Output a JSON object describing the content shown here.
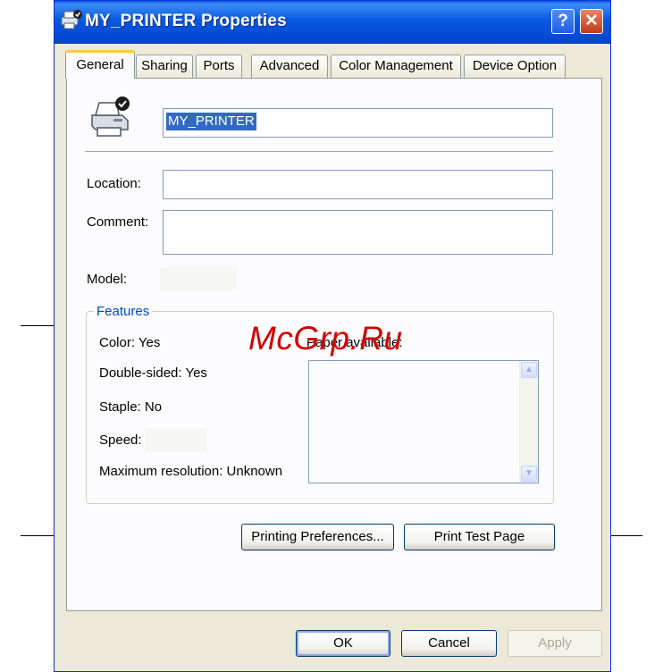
{
  "window": {
    "title": "MY_PRINTER Properties",
    "help_button": "?",
    "close_button": "✕"
  },
  "tabs": [
    {
      "label": "General",
      "active": true
    },
    {
      "label": "Sharing",
      "active": false
    },
    {
      "label": "Ports",
      "active": false
    },
    {
      "label": "Advanced",
      "active": false
    },
    {
      "label": "Color Management",
      "active": false
    },
    {
      "label": "Device Option",
      "active": false
    }
  ],
  "general": {
    "printer_name": "MY_PRINTER",
    "location_label": "Location:",
    "location_value": "",
    "comment_label": "Comment:",
    "comment_value": "",
    "model_label": "Model:",
    "model_value": ""
  },
  "features": {
    "legend": "Features",
    "color": "Color: Yes",
    "double_sided": "Double-sided: Yes",
    "staple": "Staple: No",
    "speed_label": "Speed:",
    "speed_value": "",
    "max_resolution": "Maximum resolution: Unknown",
    "paper_available_label": "Paper available:",
    "paper_list": []
  },
  "actions": {
    "printing_preferences": "Printing Preferences...",
    "print_test_page": "Print Test Page"
  },
  "footer": {
    "ok": "OK",
    "cancel": "Cancel",
    "apply": "Apply"
  },
  "watermark": "McGrp.Ru",
  "colors": {
    "titlebar": "#0858e0",
    "tab_highlight": "#ffc83c",
    "group_legend": "#0046d5",
    "close_button": "#c23a1a",
    "watermark": "#d40000"
  },
  "icons": {
    "title": "printer-icon",
    "printer": "printer-default-icon"
  }
}
